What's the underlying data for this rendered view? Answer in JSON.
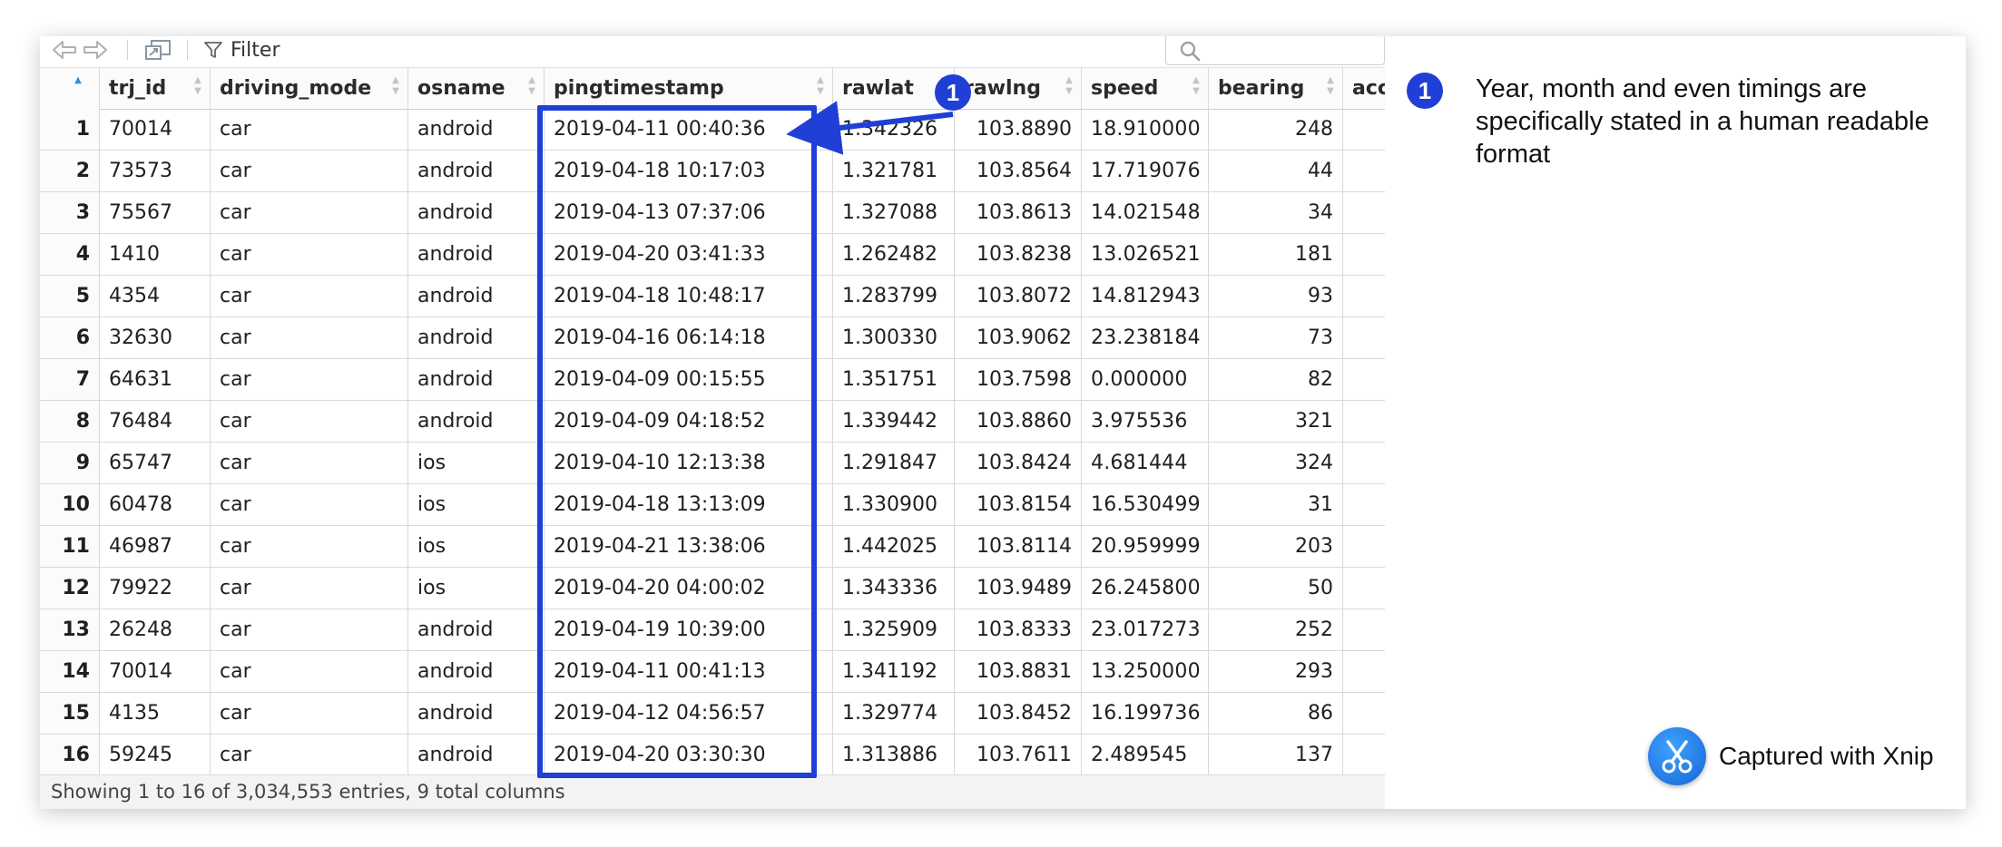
{
  "toolbar": {
    "filter_label": "Filter",
    "search_placeholder": ""
  },
  "table": {
    "columns": [
      "trj_id",
      "driving_mode",
      "osname",
      "pingtimestamp",
      "rawlat",
      "rawlng",
      "speed",
      "bearing",
      "accu"
    ],
    "rows": [
      {
        "n": "1",
        "trj_id": "70014",
        "driving_mode": "car",
        "osname": "android",
        "pingtimestamp": "2019-04-11 00:40:36",
        "rawlat": "1.342326",
        "rawlng": "103.8890",
        "speed": "18.910000",
        "bearing": "248"
      },
      {
        "n": "2",
        "trj_id": "73573",
        "driving_mode": "car",
        "osname": "android",
        "pingtimestamp": "2019-04-18 10:17:03",
        "rawlat": "1.321781",
        "rawlng": "103.8564",
        "speed": "17.719076",
        "bearing": "44"
      },
      {
        "n": "3",
        "trj_id": "75567",
        "driving_mode": "car",
        "osname": "android",
        "pingtimestamp": "2019-04-13 07:37:06",
        "rawlat": "1.327088",
        "rawlng": "103.8613",
        "speed": "14.021548",
        "bearing": "34"
      },
      {
        "n": "4",
        "trj_id": "1410",
        "driving_mode": "car",
        "osname": "android",
        "pingtimestamp": "2019-04-20 03:41:33",
        "rawlat": "1.262482",
        "rawlng": "103.8238",
        "speed": "13.026521",
        "bearing": "181"
      },
      {
        "n": "5",
        "trj_id": "4354",
        "driving_mode": "car",
        "osname": "android",
        "pingtimestamp": "2019-04-18 10:48:17",
        "rawlat": "1.283799",
        "rawlng": "103.8072",
        "speed": "14.812943",
        "bearing": "93"
      },
      {
        "n": "6",
        "trj_id": "32630",
        "driving_mode": "car",
        "osname": "android",
        "pingtimestamp": "2019-04-16 06:14:18",
        "rawlat": "1.300330",
        "rawlng": "103.9062",
        "speed": "23.238184",
        "bearing": "73"
      },
      {
        "n": "7",
        "trj_id": "64631",
        "driving_mode": "car",
        "osname": "android",
        "pingtimestamp": "2019-04-09 00:15:55",
        "rawlat": "1.351751",
        "rawlng": "103.7598",
        "speed": "0.000000",
        "bearing": "82"
      },
      {
        "n": "8",
        "trj_id": "76484",
        "driving_mode": "car",
        "osname": "android",
        "pingtimestamp": "2019-04-09 04:18:52",
        "rawlat": "1.339442",
        "rawlng": "103.8860",
        "speed": "3.975536",
        "bearing": "321"
      },
      {
        "n": "9",
        "trj_id": "65747",
        "driving_mode": "car",
        "osname": "ios",
        "pingtimestamp": "2019-04-10 12:13:38",
        "rawlat": "1.291847",
        "rawlng": "103.8424",
        "speed": "4.681444",
        "bearing": "324"
      },
      {
        "n": "10",
        "trj_id": "60478",
        "driving_mode": "car",
        "osname": "ios",
        "pingtimestamp": "2019-04-18 13:13:09",
        "rawlat": "1.330900",
        "rawlng": "103.8154",
        "speed": "16.530499",
        "bearing": "31"
      },
      {
        "n": "11",
        "trj_id": "46987",
        "driving_mode": "car",
        "osname": "ios",
        "pingtimestamp": "2019-04-21 13:38:06",
        "rawlat": "1.442025",
        "rawlng": "103.8114",
        "speed": "20.959999",
        "bearing": "203"
      },
      {
        "n": "12",
        "trj_id": "79922",
        "driving_mode": "car",
        "osname": "ios",
        "pingtimestamp": "2019-04-20 04:00:02",
        "rawlat": "1.343336",
        "rawlng": "103.9489",
        "speed": "26.245800",
        "bearing": "50"
      },
      {
        "n": "13",
        "trj_id": "26248",
        "driving_mode": "car",
        "osname": "android",
        "pingtimestamp": "2019-04-19 10:39:00",
        "rawlat": "1.325909",
        "rawlng": "103.8333",
        "speed": "23.017273",
        "bearing": "252"
      },
      {
        "n": "14",
        "trj_id": "70014",
        "driving_mode": "car",
        "osname": "android",
        "pingtimestamp": "2019-04-11 00:41:13",
        "rawlat": "1.341192",
        "rawlng": "103.8831",
        "speed": "13.250000",
        "bearing": "293"
      },
      {
        "n": "15",
        "trj_id": "4135",
        "driving_mode": "car",
        "osname": "android",
        "pingtimestamp": "2019-04-12 04:56:57",
        "rawlat": "1.329774",
        "rawlng": "103.8452",
        "speed": "16.199736",
        "bearing": "86"
      },
      {
        "n": "16",
        "trj_id": "59245",
        "driving_mode": "car",
        "osname": "android",
        "pingtimestamp": "2019-04-20 03:30:30",
        "rawlat": "1.313886",
        "rawlng": "103.7611",
        "speed": "2.489545",
        "bearing": "137"
      }
    ]
  },
  "footer": {
    "status_text": "Showing 1 to 16 of 3,034,553 entries, 9 total columns"
  },
  "annotation": {
    "marker": "1",
    "note": "Year, month and even timings are specifically stated in a human readable format",
    "color": "#1f3fd6"
  },
  "watermark": {
    "text": "Captured with Xnip"
  },
  "icons": {
    "back": "back-arrow-icon",
    "forward": "forward-arrow-icon",
    "popout": "popout-window-icon",
    "filter": "filter-funnel-icon",
    "search": "search-icon",
    "xnip": "xnip-scissors-icon"
  }
}
